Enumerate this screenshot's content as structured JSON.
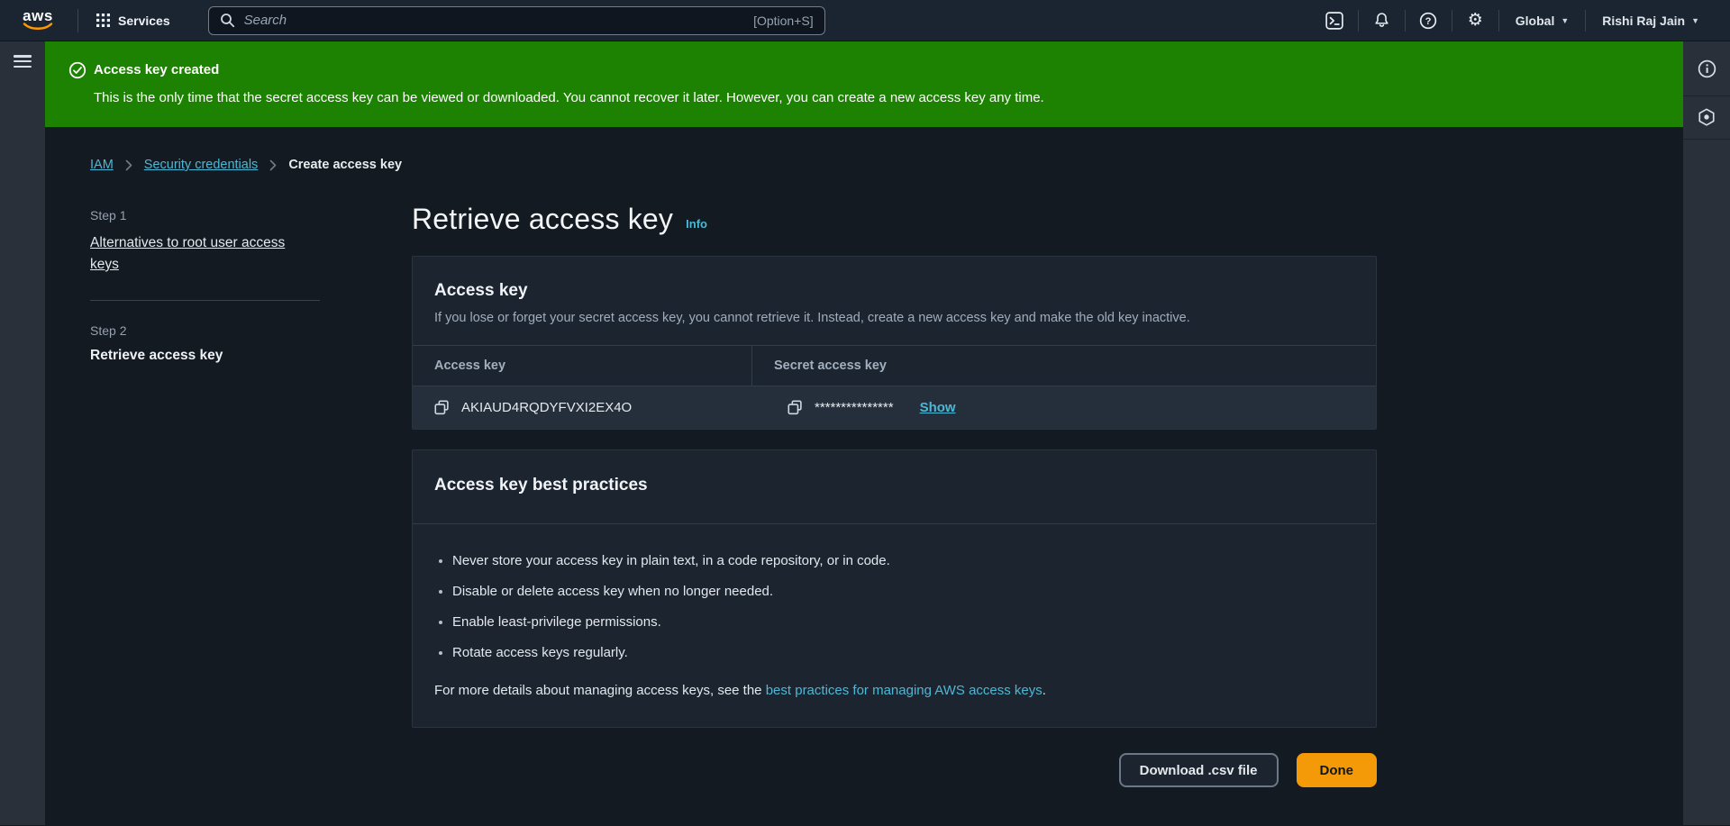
{
  "topbar": {
    "logo_text": "aws",
    "services_label": "Services",
    "search": {
      "placeholder": "Search",
      "shortcut": "[Option+S]"
    },
    "region_label": "Global",
    "user_name": "Rishi Raj Jain",
    "icons": [
      "grid-icon",
      "search-icon",
      "cloudshell-icon",
      "bell-icon",
      "help-icon",
      "gear-icon"
    ]
  },
  "banner": {
    "title": "Access key created",
    "message": "This is the only time that the secret access key can be viewed or downloaded. You cannot recover it later. However, you can create a new access key any time.",
    "icon": "check-circle-icon"
  },
  "breadcrumb": {
    "items": [
      "IAM",
      "Security credentials",
      "Create access key"
    ]
  },
  "steps": {
    "step1_label": "Step 1",
    "step1_title": "Alternatives to root user access keys",
    "step2_label": "Step 2",
    "step2_title": "Retrieve access key"
  },
  "page": {
    "title": "Retrieve access key",
    "info_label": "Info"
  },
  "access_key_card": {
    "title": "Access key",
    "description": "If you lose or forget your secret access key, you cannot retrieve it. Instead, create a new access key and make the old key inactive.",
    "col_access_key": "Access key",
    "col_secret": "Secret access key",
    "access_key_value": "AKIAUD4RQDYFVXI2EX4O",
    "secret_masked": "***************",
    "show_label": "Show",
    "icons": [
      "copy-icon"
    ]
  },
  "best_practices": {
    "title": "Access key best practices",
    "bullets": [
      "Never store your access key in plain text, in a code repository, or in code.",
      "Disable or delete access key when no longer needed.",
      "Enable least-privilege permissions.",
      "Rotate access keys regularly."
    ],
    "footer_prefix": "For more details about managing access keys, see the ",
    "footer_link_text": "best practices for managing AWS access keys",
    "footer_suffix": "."
  },
  "actions": {
    "download_csv_label": "Download .csv file",
    "done_label": "Done"
  },
  "side_rails": {
    "icons": [
      "hamburger-icon",
      "info-circle-icon",
      "hexagon-q-icon"
    ]
  },
  "colors": {
    "success_green": "#1d8102",
    "primary_orange": "#f49908",
    "link_teal": "#4cb8d5",
    "topbar_bg": "#1b2532",
    "page_bg": "#141a21",
    "card_bg": "#1c242f"
  }
}
